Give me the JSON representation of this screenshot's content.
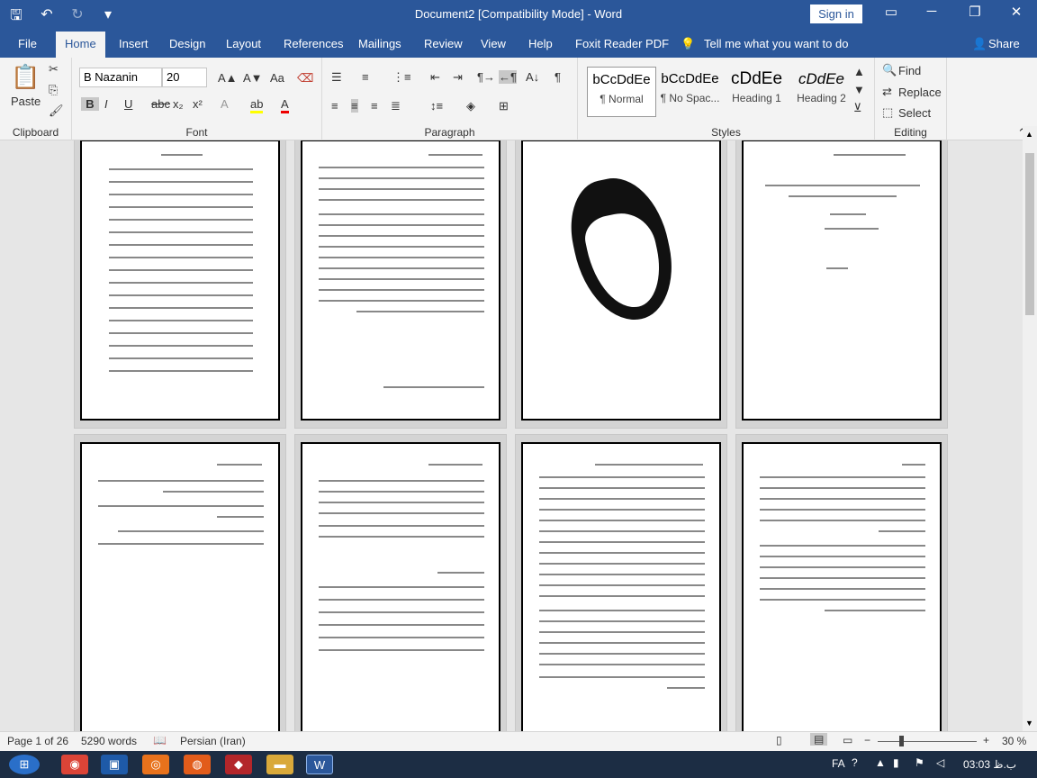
{
  "window": {
    "title": "Document2 [Compatibility Mode]  -  Word",
    "signin": "Sign in"
  },
  "tabs": [
    "File",
    "Home",
    "Insert",
    "Design",
    "Layout",
    "References",
    "Mailings",
    "Review",
    "View",
    "Help",
    "Foxit Reader PDF",
    "Tell me what you want to do",
    "Share"
  ],
  "ribbon": {
    "clipboard": {
      "label": "Clipboard",
      "paste": "Paste"
    },
    "font": {
      "label": "Font",
      "name": "B Nazanin",
      "size": "20"
    },
    "paragraph": {
      "label": "Paragraph"
    },
    "styles": {
      "label": "Styles",
      "items": [
        {
          "sample": "bCcDdEe",
          "name": "¶ Normal"
        },
        {
          "sample": "bCcDdEe",
          "name": "¶ No Spac..."
        },
        {
          "sample": "cDdEe",
          "name": "Heading 1"
        },
        {
          "sample": "cDdEe",
          "name": "Heading 2"
        }
      ]
    },
    "editing": {
      "label": "Editing",
      "find": "Find",
      "replace": "Replace",
      "select": "Select"
    }
  },
  "status": {
    "page": "Page 1 of 26",
    "words": "5290 words",
    "language": "Persian (Iran)",
    "zoom": "30 %"
  },
  "taskbar": {
    "lang": "FA",
    "time": "03:03 ب.ظ"
  },
  "colors": {
    "accent": "#2b579a",
    "taskbar": "#1c2d44"
  }
}
